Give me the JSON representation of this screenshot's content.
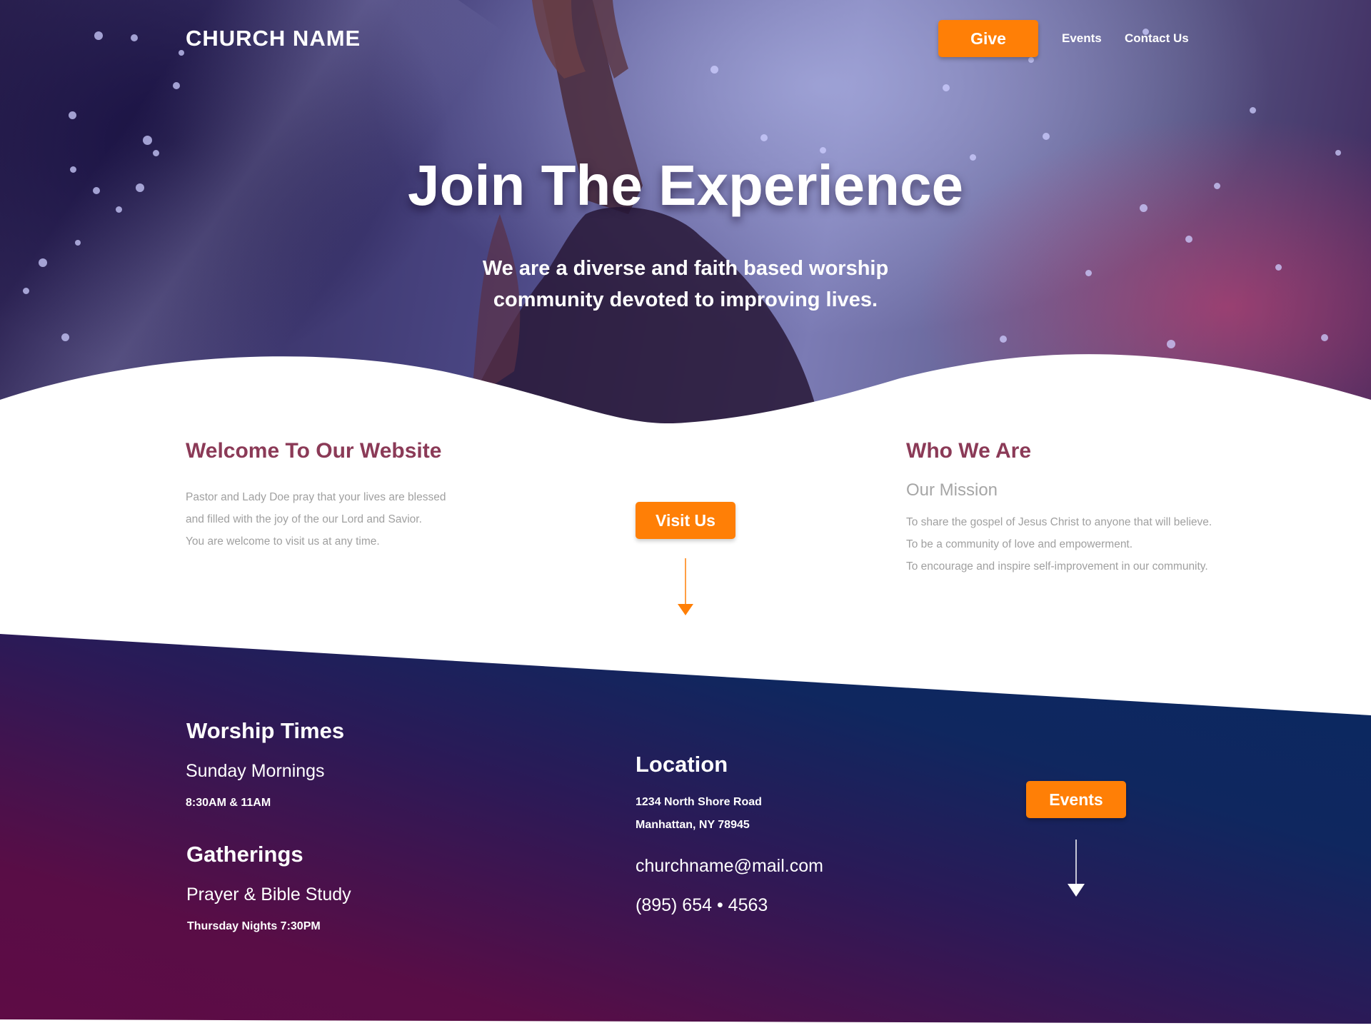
{
  "header": {
    "logo": "CHURCH NAME",
    "give_label": "Give",
    "nav": [
      {
        "label": "Events"
      },
      {
        "label": "Contact Us"
      }
    ]
  },
  "hero": {
    "title": "Join The Experience",
    "subtitle": "We are a diverse and faith based worship community devoted to improving lives."
  },
  "welcome": {
    "heading": "Welcome To Our Website",
    "lines": [
      "Pastor and Lady Doe pray that your lives are blessed",
      "and filled with the joy of the our Lord and Savior.",
      "You are welcome to visit us at any time."
    ],
    "visit_label": "Visit Us"
  },
  "who": {
    "heading": "Who We Are",
    "subheading": "Our Mission",
    "lines": [
      "To share the gospel of Jesus Christ to anyone that will believe.",
      "To be a community of love and empowerment.",
      "To encourage and inspire self-improvement in our community."
    ]
  },
  "worship": {
    "title": "Worship Times",
    "subtitle": "Sunday Mornings",
    "times": "8:30AM & 11AM"
  },
  "gatherings": {
    "title": "Gatherings",
    "subtitle": "Prayer & Bible Study",
    "times": "Thursday Nights 7:30PM"
  },
  "location": {
    "title": "Location",
    "address_line1": "1234 North Shore Road",
    "address_line2": "Manhattan, NY 78945",
    "email": "churchname@mail.com",
    "phone": "(895) 654 • 4563"
  },
  "events": {
    "label": "Events"
  },
  "colors": {
    "accent": "#ff7f06",
    "heading": "#8b3a57",
    "body_text": "#a0a0a0",
    "bottom_left": "#5e0c45",
    "bottom_right": "#0a2861"
  }
}
